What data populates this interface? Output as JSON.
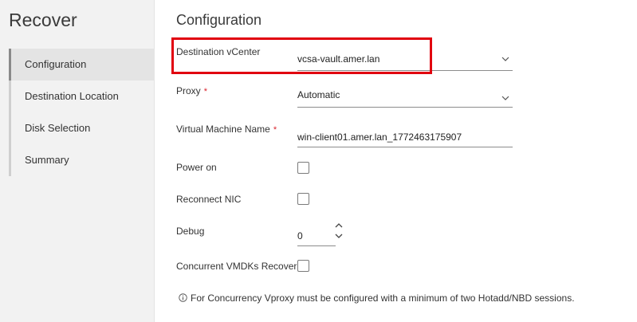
{
  "sidebar": {
    "title": "Recover",
    "steps": [
      {
        "label": "Configuration",
        "active": true
      },
      {
        "label": "Destination Location",
        "active": false
      },
      {
        "label": "Disk Selection",
        "active": false
      },
      {
        "label": "Summary",
        "active": false
      }
    ]
  },
  "main": {
    "title": "Configuration",
    "destination_vcenter": {
      "label": "Destination vCenter",
      "value": "vcsa-vault.amer.lan",
      "icon": "chevron-down-icon"
    },
    "proxy": {
      "label": "Proxy",
      "required_mark": "*",
      "value": "Automatic",
      "icon": "chevron-down-icon"
    },
    "vm_name": {
      "label": "Virtual Machine Name",
      "required_mark": "*",
      "value": "win-client01.amer.lan_1772463175907"
    },
    "power_on": {
      "label": "Power on",
      "checked": false
    },
    "reconnect_nic": {
      "label": "Reconnect NIC",
      "checked": false
    },
    "debug": {
      "label": "Debug",
      "value": "0"
    },
    "concurrent_vmdks": {
      "label": "Concurrent VMDKs Recover",
      "checked": false
    },
    "info_message": "For Concurrency Vproxy must be configured with a minimum of two Hotadd/NBD sessions."
  },
  "colors": {
    "highlight": "#e1000f",
    "required": "#d9232d",
    "sidebar_bg": "#f2f2f2"
  }
}
